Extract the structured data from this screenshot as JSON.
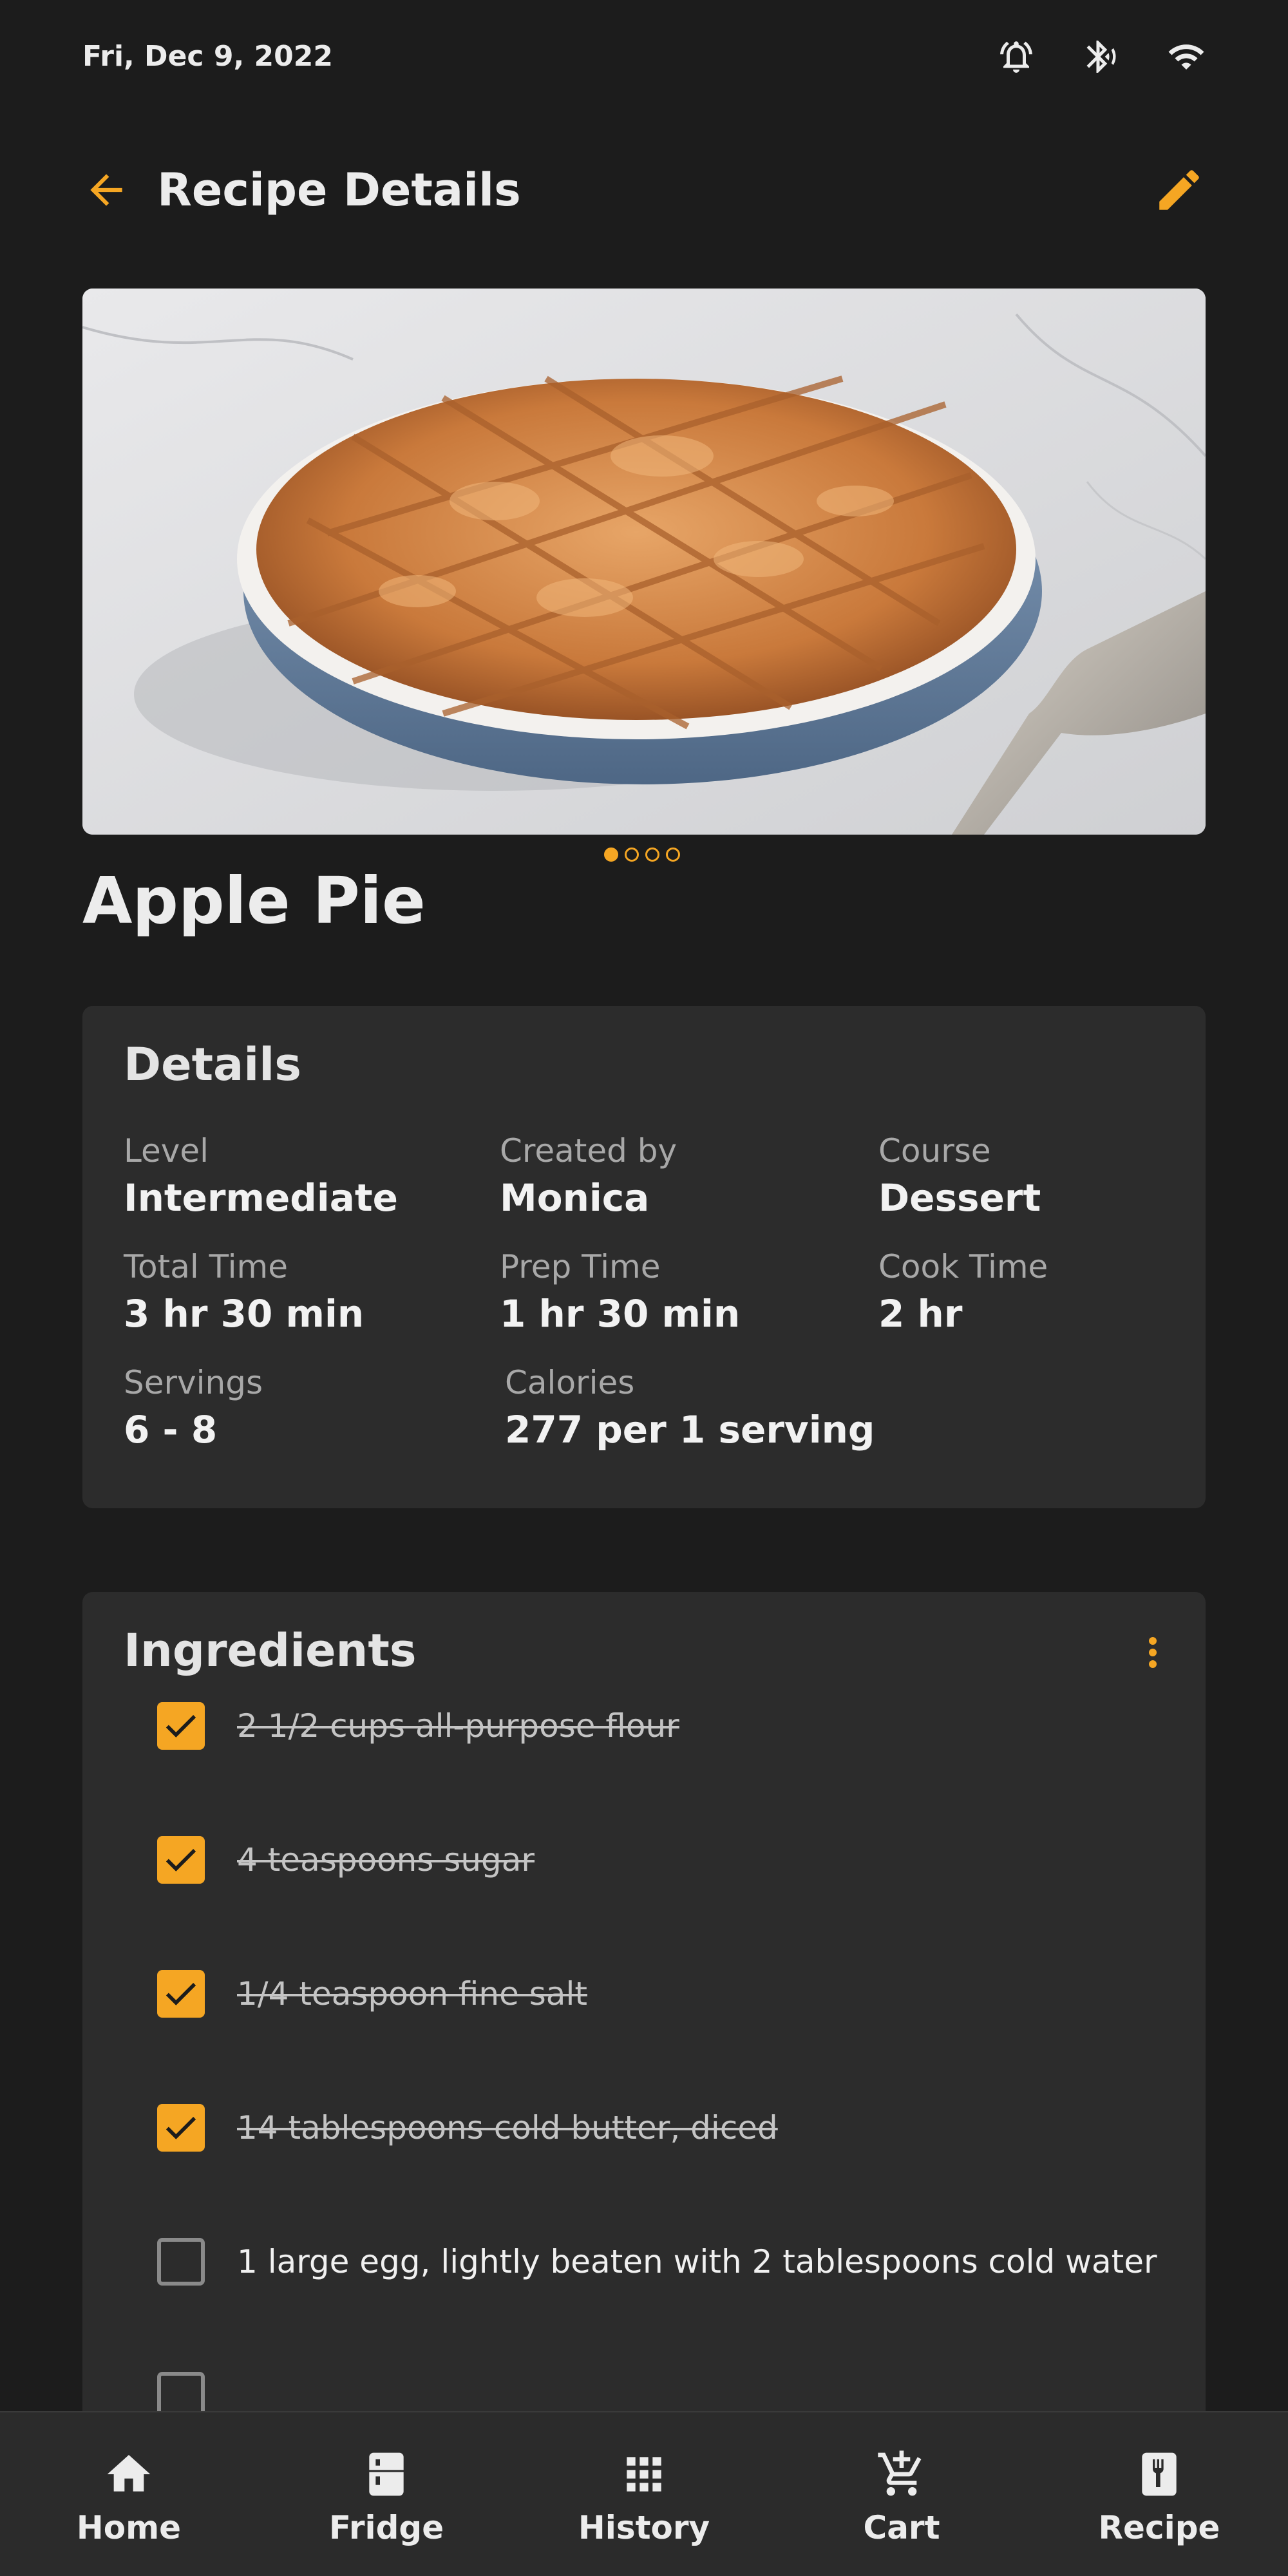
{
  "status_bar": {
    "date": "Fri, Dec 9, 2022",
    "icons": [
      "alarm-icon",
      "bluetooth-icon",
      "wifi-icon"
    ]
  },
  "app_bar": {
    "title": "Recipe Details",
    "back_icon": "arrow-back-icon",
    "edit_icon": "pencil-icon"
  },
  "hero": {
    "pages_count": 4,
    "active_page": 1
  },
  "recipe": {
    "name": "Apple Pie"
  },
  "details": {
    "title": "Details",
    "level_label": "Level",
    "level_value": "Intermediate",
    "created_by_label": "Created by",
    "created_by_value": "Monica",
    "course_label": "Course",
    "course_value": "Dessert",
    "total_time_label": "Total Time",
    "total_time_value": "3 hr 30 min",
    "prep_time_label": "Prep Time",
    "prep_time_value": "1 hr 30 min",
    "cook_time_label": "Cook Time",
    "cook_time_value": "2 hr",
    "servings_label": "Servings",
    "servings_value": "6 - 8",
    "calories_label": "Calories",
    "calories_value": "277 per 1 serving"
  },
  "ingredients": {
    "title": "Ingredients",
    "items": [
      {
        "text": "2 1/2 cups all-purpose flour",
        "checked": true
      },
      {
        "text": "4 teaspoons sugar",
        "checked": true
      },
      {
        "text": "1/4 teaspoon fine salt",
        "checked": true
      },
      {
        "text": "14 tablespoons cold butter, diced",
        "checked": true
      },
      {
        "text": "1 large egg, lightly beaten with 2 tablespoons cold water",
        "checked": false
      }
    ]
  },
  "bottom_nav": {
    "items": [
      {
        "label": "Home",
        "icon": "home-icon"
      },
      {
        "label": "Fridge",
        "icon": "fridge-icon"
      },
      {
        "label": "History",
        "icon": "grid-icon"
      },
      {
        "label": "Cart",
        "icon": "cart-icon"
      },
      {
        "label": "Recipe",
        "icon": "recipe-book-icon"
      }
    ]
  },
  "colors": {
    "accent": "#f5a623",
    "background": "#1c1c1c",
    "card": "#2c2c2c"
  }
}
